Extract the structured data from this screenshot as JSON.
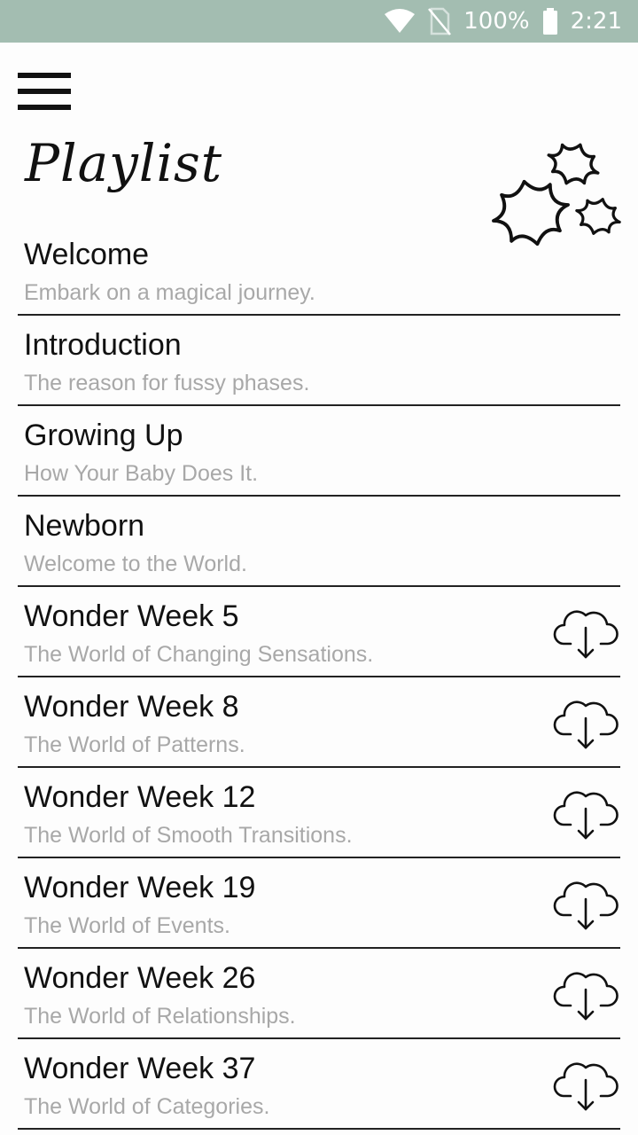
{
  "status_bar": {
    "battery": "100%",
    "time": "2:21",
    "background": "#a3bdb1"
  },
  "header": {
    "title": "Playlist"
  },
  "playlist": [
    {
      "title": "Welcome",
      "subtitle": "Embark on a magical journey.",
      "download": false
    },
    {
      "title": "Introduction",
      "subtitle": "The reason for fussy phases.",
      "download": false
    },
    {
      "title": "Growing Up",
      "subtitle": "How Your Baby Does It.",
      "download": false
    },
    {
      "title": "Newborn",
      "subtitle": "Welcome to the World.",
      "download": false
    },
    {
      "title": "Wonder Week 5",
      "subtitle": "The World of Changing Sensations.",
      "download": true
    },
    {
      "title": "Wonder Week 8",
      "subtitle": "The World of Patterns.",
      "download": true
    },
    {
      "title": "Wonder Week 12",
      "subtitle": "The World of Smooth Transitions.",
      "download": true
    },
    {
      "title": "Wonder Week 19",
      "subtitle": "The World of Events.",
      "download": true
    },
    {
      "title": "Wonder Week 26",
      "subtitle": "The World of Relationships.",
      "download": true
    },
    {
      "title": "Wonder Week 37",
      "subtitle": "The World of Categories.",
      "download": true
    }
  ],
  "icons": {
    "menu": "hamburger-menu-icon",
    "decoration": "stars-icon",
    "download": "cloud-download-icon",
    "wifi": "wifi-icon",
    "no_sim": "no-sim-icon",
    "battery": "battery-icon"
  }
}
